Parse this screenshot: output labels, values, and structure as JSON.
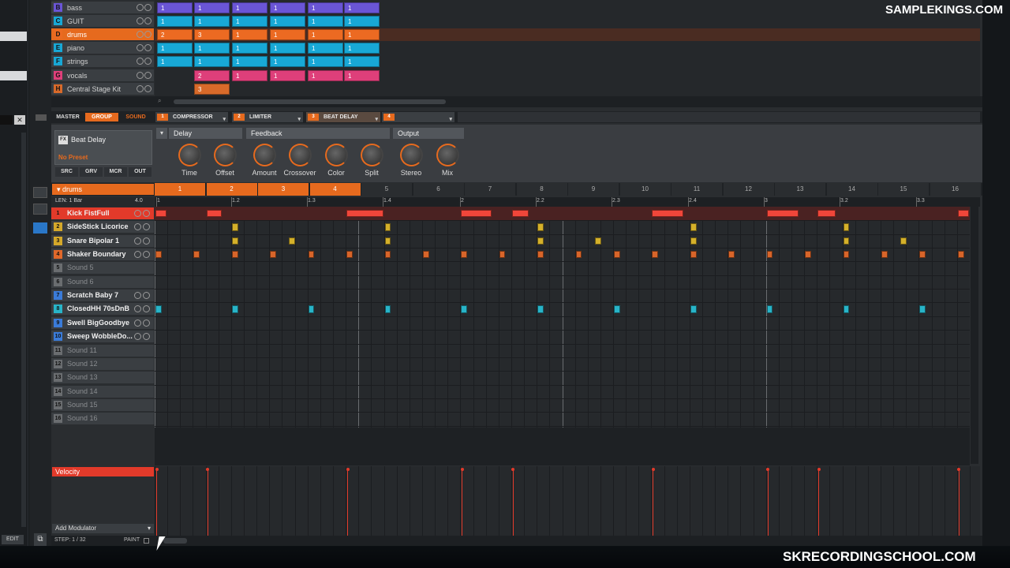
{
  "watermark_top": "SAMPLEKINGS.COM",
  "watermark_bottom": "SKRECORDINGSCHOOL.COM",
  "groups": [
    {
      "letter": "B",
      "name": "bass",
      "color": "#6a55d6",
      "cells": [
        "1",
        "1",
        "1",
        "1",
        "1",
        "1"
      ]
    },
    {
      "letter": "C",
      "name": "GUIT",
      "color": "#18a8d6",
      "cells": [
        "1",
        "1",
        "1",
        "1",
        "1",
        "1"
      ]
    },
    {
      "letter": "D",
      "name": "drums",
      "color": "#ec6a22",
      "cells": [
        "2",
        "3",
        "1",
        "1",
        "1",
        "1"
      ]
    },
    {
      "letter": "E",
      "name": "piano",
      "color": "#18a8d6",
      "cells": [
        "1",
        "1",
        "1",
        "1",
        "1",
        "1"
      ]
    },
    {
      "letter": "F",
      "name": "strings",
      "color": "#18a8d6",
      "cells": [
        "1",
        "1",
        "1",
        "1",
        "1",
        "1"
      ]
    },
    {
      "letter": "G",
      "name": "vocals",
      "color": "#de3f7a",
      "cells": [
        "",
        "2",
        "1",
        "1",
        "1",
        "1"
      ]
    },
    {
      "letter": "H",
      "name": "Central Stage Kit",
      "color": "#d86a2a",
      "cells": [
        "",
        "3",
        "",
        "",
        "",
        ""
      ]
    }
  ],
  "fx": {
    "tabs": [
      "MASTER",
      "GROUP",
      "SOUND"
    ],
    "slots": [
      {
        "num": "1",
        "name": "COMPRESSOR"
      },
      {
        "num": "2",
        "name": "LIMITER"
      },
      {
        "num": "3",
        "name": "BEAT DELAY"
      },
      {
        "num": "4",
        "name": ""
      }
    ],
    "plugin": "Beat Delay",
    "preset": "No Preset",
    "buttons": [
      "SRC",
      "GRV",
      "MCR",
      "OUT"
    ],
    "sections": [
      "Delay",
      "Feedback",
      "Output"
    ],
    "knobs": [
      "Time",
      "Offset",
      "Amount",
      "Crossover",
      "Color",
      "Split",
      "Stereo",
      "Mix"
    ]
  },
  "pattern": {
    "group": "drums",
    "len": "LEN: 1 Bar",
    "len_val": "4.0",
    "patterns": [
      "1",
      "2",
      "3",
      "4",
      "5",
      "6",
      "7",
      "8",
      "9",
      "10",
      "11",
      "12",
      "13",
      "14",
      "15",
      "16"
    ],
    "ruler": [
      "1",
      "1.2",
      "1.3",
      "1.4",
      "2",
      "2.2",
      "2.3",
      "2.4",
      "3",
      "3.2",
      "3.3"
    ],
    "sounds": [
      {
        "n": "1",
        "name": "Kick FistFull",
        "color": "#e23a2a",
        "active": true
      },
      {
        "n": "2",
        "name": "SideStick Licorice",
        "color": "#d4a82a"
      },
      {
        "n": "3",
        "name": "Snare Bipolar 1",
        "color": "#d4a82a"
      },
      {
        "n": "4",
        "name": "Shaker Boundary",
        "color": "#e0682a"
      },
      {
        "n": "5",
        "name": "Sound 5",
        "color": "#6a6d70",
        "empty": true
      },
      {
        "n": "6",
        "name": "Sound 6",
        "color": "#6a6d70",
        "empty": true
      },
      {
        "n": "7",
        "name": "Scratch Baby 7",
        "color": "#3a7bd8"
      },
      {
        "n": "8",
        "name": "ClosedHH 70sDnB",
        "color": "#28b4c8"
      },
      {
        "n": "9",
        "name": "Swell BigGoodbye",
        "color": "#3a7bd8"
      },
      {
        "n": "10",
        "name": "Sweep WobbleDo...",
        "color": "#3a7bd8"
      },
      {
        "n": "11",
        "name": "Sound 11",
        "color": "#6a6d70",
        "empty": true
      },
      {
        "n": "12",
        "name": "Sound 12",
        "color": "#6a6d70",
        "empty": true
      },
      {
        "n": "13",
        "name": "Sound 13",
        "color": "#6a6d70",
        "empty": true
      },
      {
        "n": "14",
        "name": "Sound 14",
        "color": "#6a6d70",
        "empty": true
      },
      {
        "n": "15",
        "name": "Sound 15",
        "color": "#6a6d70",
        "empty": true
      },
      {
        "n": "16",
        "name": "Sound 16",
        "color": "#6a6d70",
        "empty": true
      }
    ],
    "velocity_label": "Velocity",
    "add_modulator": "Add Modulator",
    "step": "STEP: 1 / 32",
    "paint": "PAINT",
    "edit": "EDIT"
  }
}
